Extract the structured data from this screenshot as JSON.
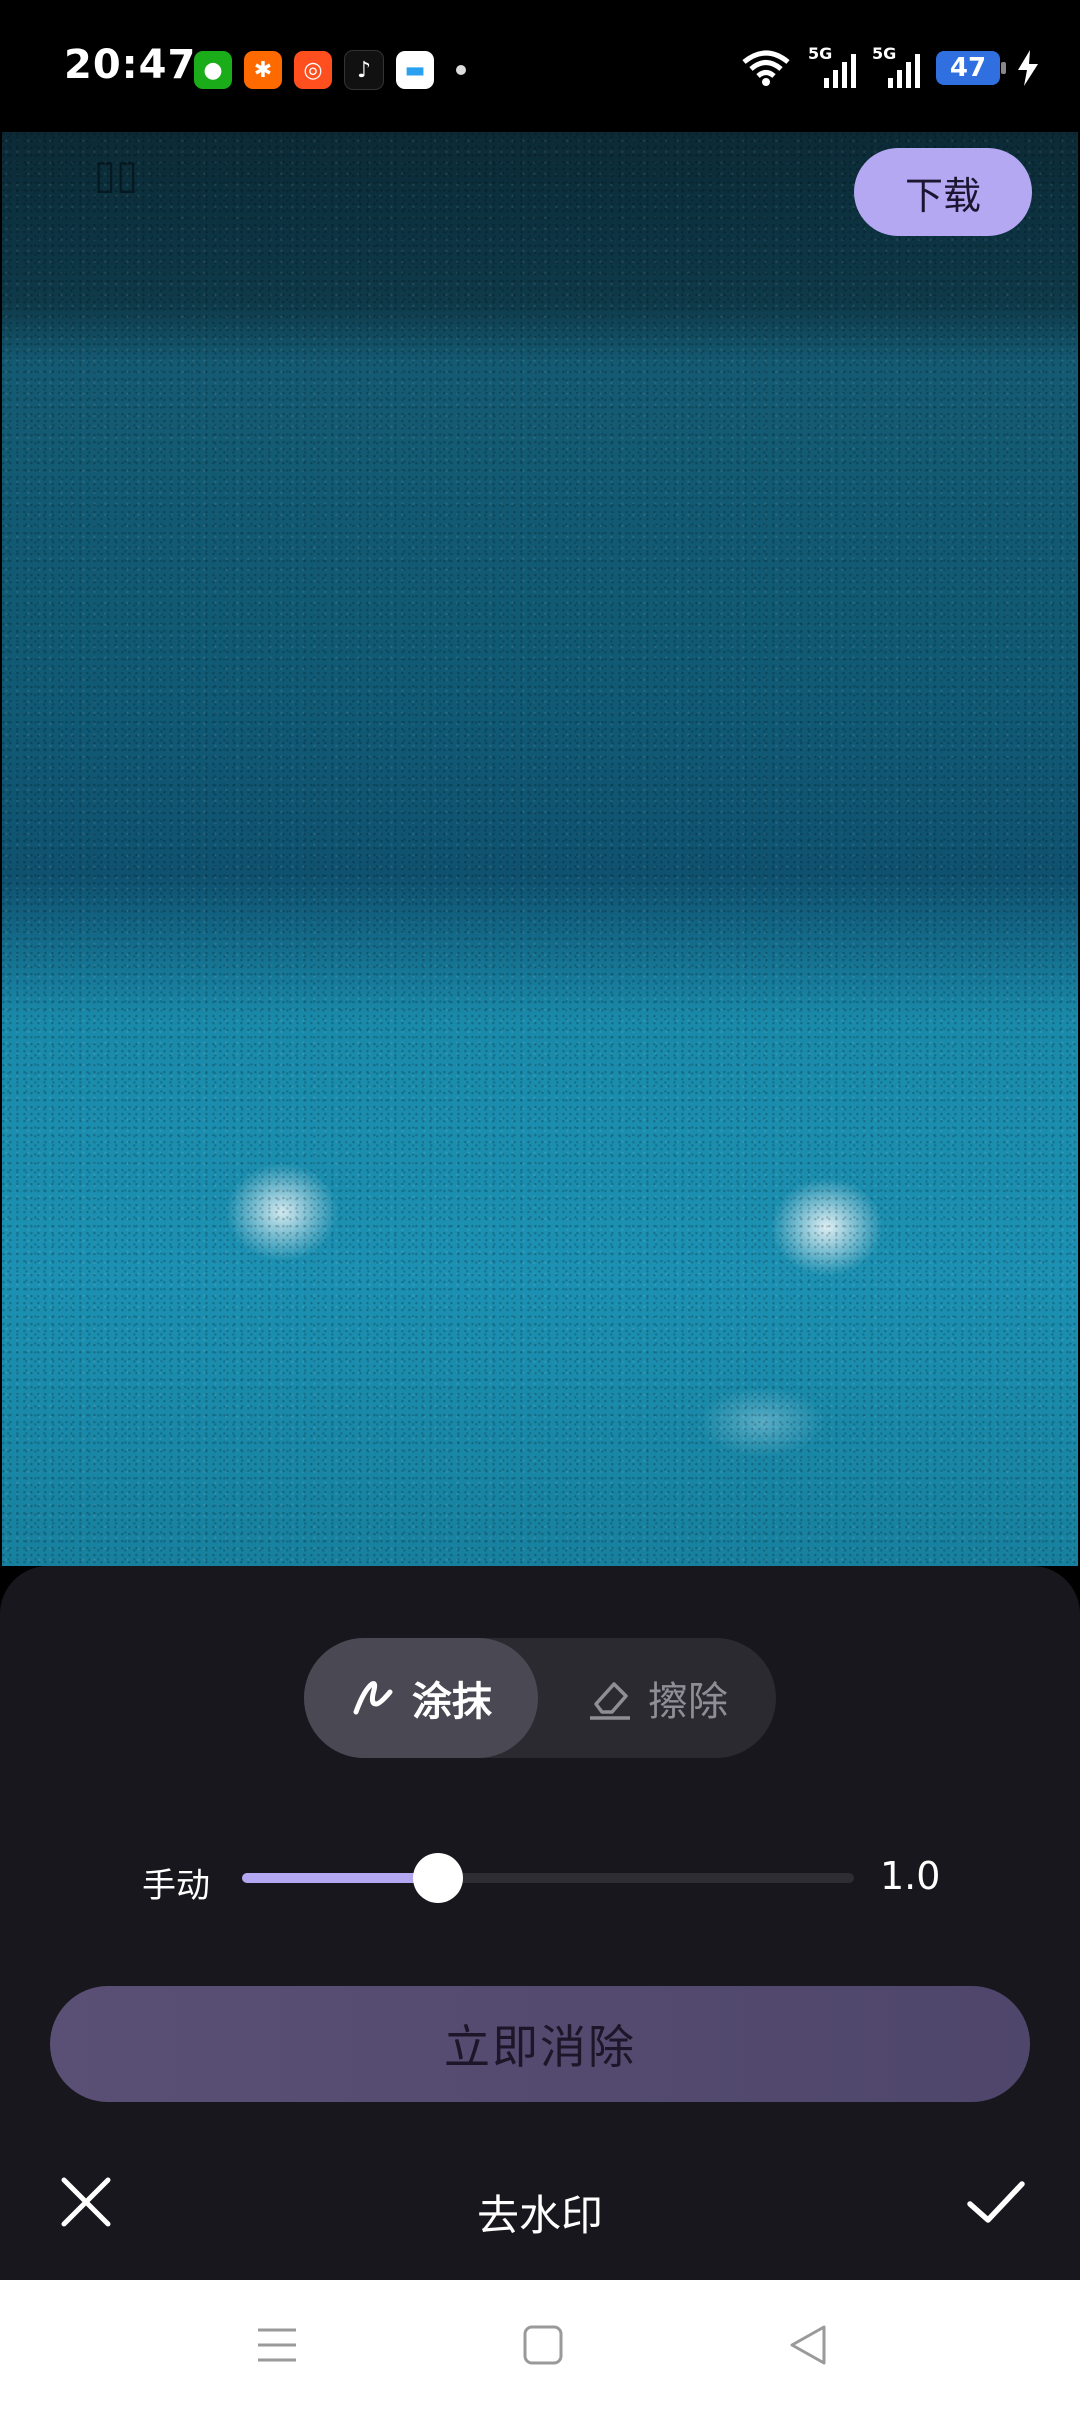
{
  "status_bar": {
    "time": "20:47",
    "signal1_label": "5G",
    "signal2_label": "5G",
    "battery": "47",
    "app_icons": [
      "wechat-icon",
      "taobao-icon",
      "app-icon",
      "tiktok-icon",
      "wallet-icon"
    ]
  },
  "photo": {
    "download_label": "下载"
  },
  "panel": {
    "mode_smear": "涂抹",
    "mode_erase": "擦除",
    "slider_label": "手动",
    "slider_value": "1.0",
    "slider_level_fraction": 0.32,
    "erase_now": "立即消除",
    "title": "去水印"
  },
  "colors": {
    "accent": "#b5a8f3",
    "panel_bg": "#18171d",
    "erase_button": "#564c71"
  }
}
